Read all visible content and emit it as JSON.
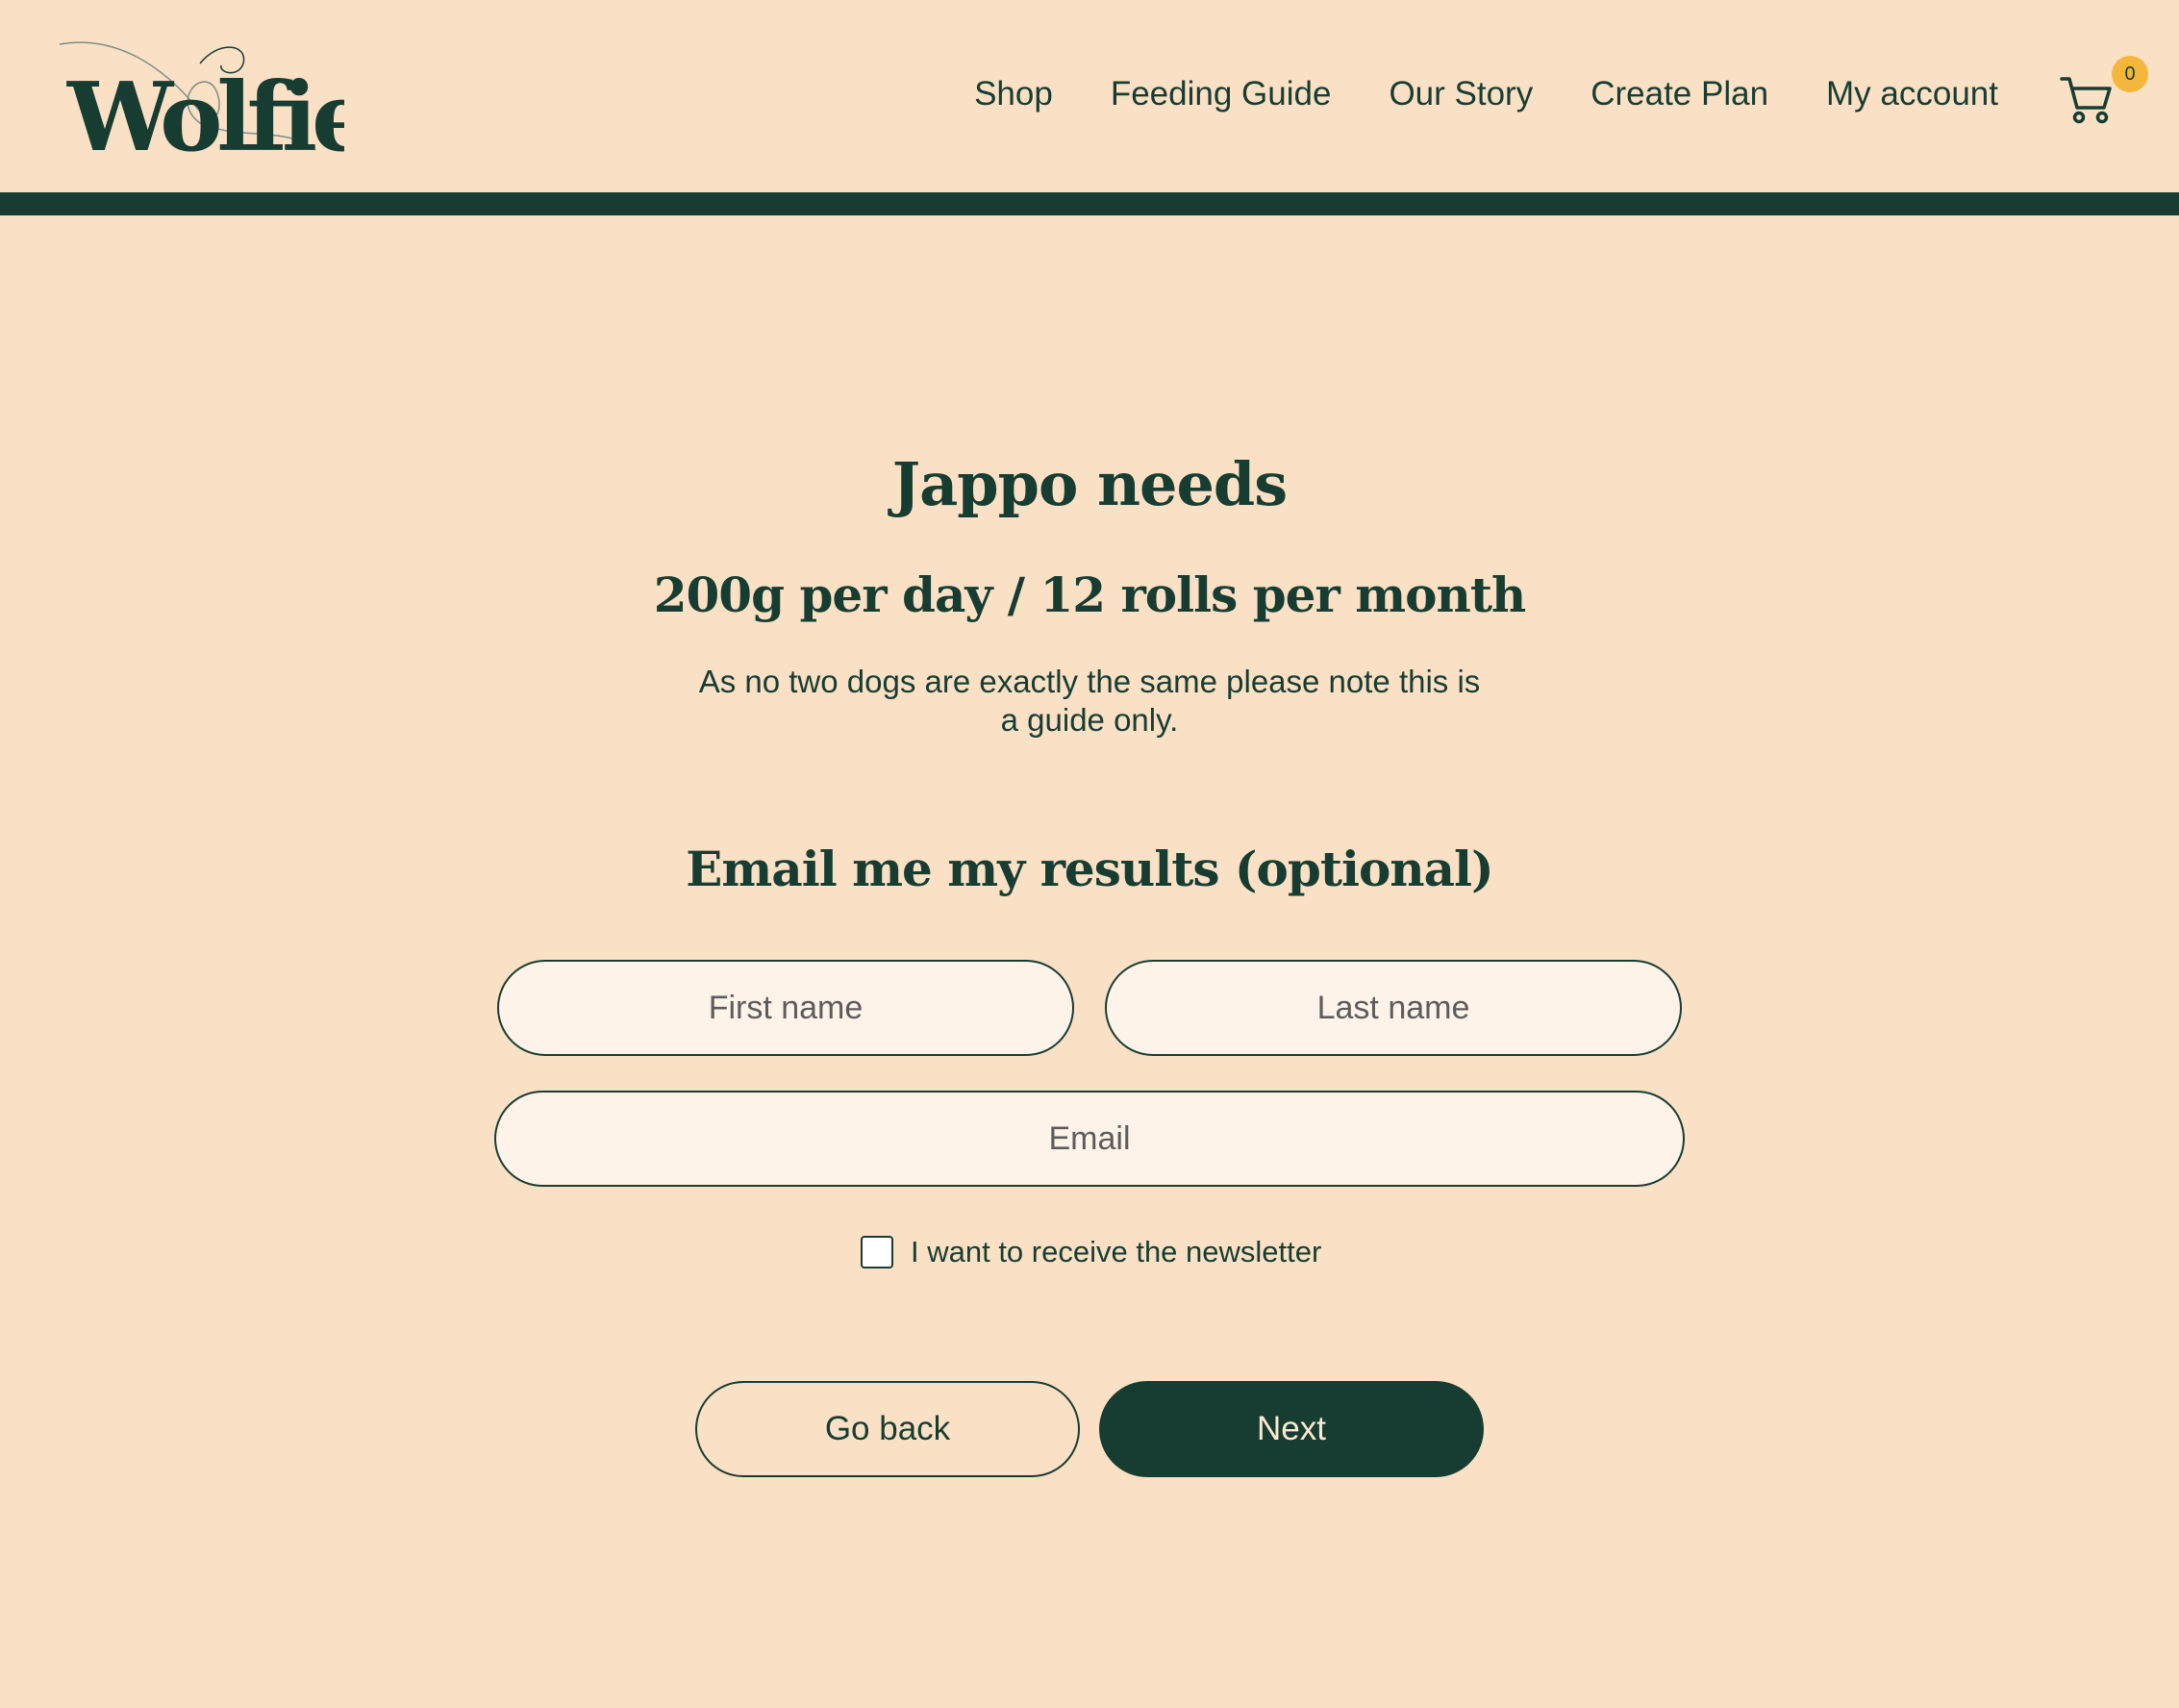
{
  "header": {
    "logo_text": "Wolfie",
    "nav": [
      "Shop",
      "Feeding Guide",
      "Our Story",
      "Create Plan",
      "My account"
    ],
    "cart_count": "0"
  },
  "result": {
    "title": "Jappo needs",
    "amount": "200g per day / 12 rolls per month",
    "note": "As no two dogs are exactly the same please note this is a guide only."
  },
  "email_form": {
    "heading": "Email me my results (optional)",
    "first_name_placeholder": "First name",
    "last_name_placeholder": "Last name",
    "email_placeholder": "Email",
    "newsletter_label": "I want to receive the newsletter",
    "newsletter_checked": false
  },
  "actions": {
    "back_label": "Go back",
    "next_label": "Next"
  },
  "colors": {
    "background": "#FAE0C4",
    "primary": "#173D32",
    "field_bg": "#FDF3E8",
    "badge": "#F4B73B"
  },
  "icons": {
    "cart": "cart-icon",
    "logo_dog": "dog-silhouette-icon"
  }
}
